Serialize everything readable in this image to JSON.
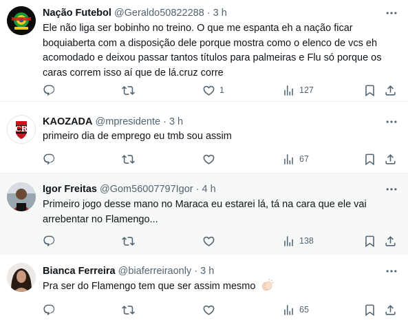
{
  "tweets": [
    {
      "name": "Nação Futebol",
      "handle": "@Geraldo50822288",
      "time": "3 h",
      "lines": [
        "Ele não liga ser bobinho no treino. O que me espanta eh a nação ficar",
        "boquiaberta com a disposição dele porque mostra como o elenco de vcs eh",
        "acomodado e deixou passar tantos títulos para palmeiras e Flu só porque os",
        "caras correm isso aí que de lá.cruz corre"
      ],
      "likes": "1",
      "views": "127",
      "avatar_icon": "nacao-futebol-logo-icon"
    },
    {
      "name": "KAOZADA",
      "handle": "@mpresidente",
      "time": "3 h",
      "lines": [
        "primeiro dia de emprego eu tmb sou assim"
      ],
      "likes": "",
      "views": "67",
      "avatar_icon": "flamengo-crest-icon"
    },
    {
      "name": "Igor Freitas",
      "handle": "@Gom56007797Igor",
      "time": "4 h",
      "lines": [
        "Primeiro jogo desse mano no Maraca eu estarei lá, tá na cara que ele vai",
        "arrebentar no Flamengo..."
      ],
      "likes": "",
      "views": "138",
      "avatar_icon": "user-photo-icon"
    },
    {
      "name": "Bianca Ferreira",
      "handle": "@biaferreiraonly",
      "time": "3 h",
      "lines": [
        "Pra ser do Flamengo tem que ser assim mesmo"
      ],
      "emoji": "clapping-hands-emoji",
      "likes": "",
      "views": "65",
      "avatar_icon": "user-photo-icon"
    }
  ],
  "colors": {
    "text": "#0f1419",
    "muted": "#536471",
    "border": "#eff3f4",
    "highlight_bg": "#f7f9f9"
  }
}
